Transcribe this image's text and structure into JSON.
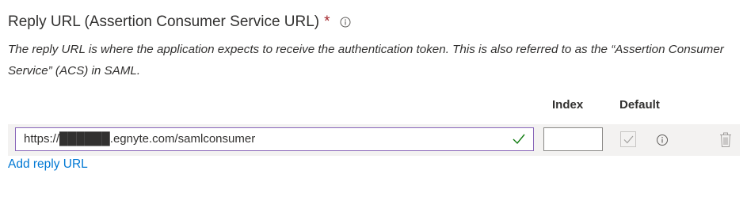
{
  "section": {
    "title": "Reply URL (Assertion Consumer Service URL)",
    "required_marker": "*",
    "description": "The reply URL is where the application expects to receive the authentication token. This is also referred to as the “Assertion Consumer Service” (ACS) in SAML."
  },
  "table": {
    "headers": {
      "index": "Index",
      "default": "Default"
    },
    "rows": [
      {
        "url": "https://██████.egnyte.com/samlconsumer",
        "index": "",
        "default_checked": true,
        "default_disabled": true,
        "valid": true
      }
    ]
  },
  "actions": {
    "add_reply_url": "Add reply URL"
  },
  "icons": {
    "info": "info-icon",
    "valid": "check-icon",
    "delete": "trash-icon"
  },
  "colors": {
    "accent": "#0078d4",
    "required": "#a4262c",
    "valid_check": "#107c10",
    "focus_border": "#8764b8"
  }
}
